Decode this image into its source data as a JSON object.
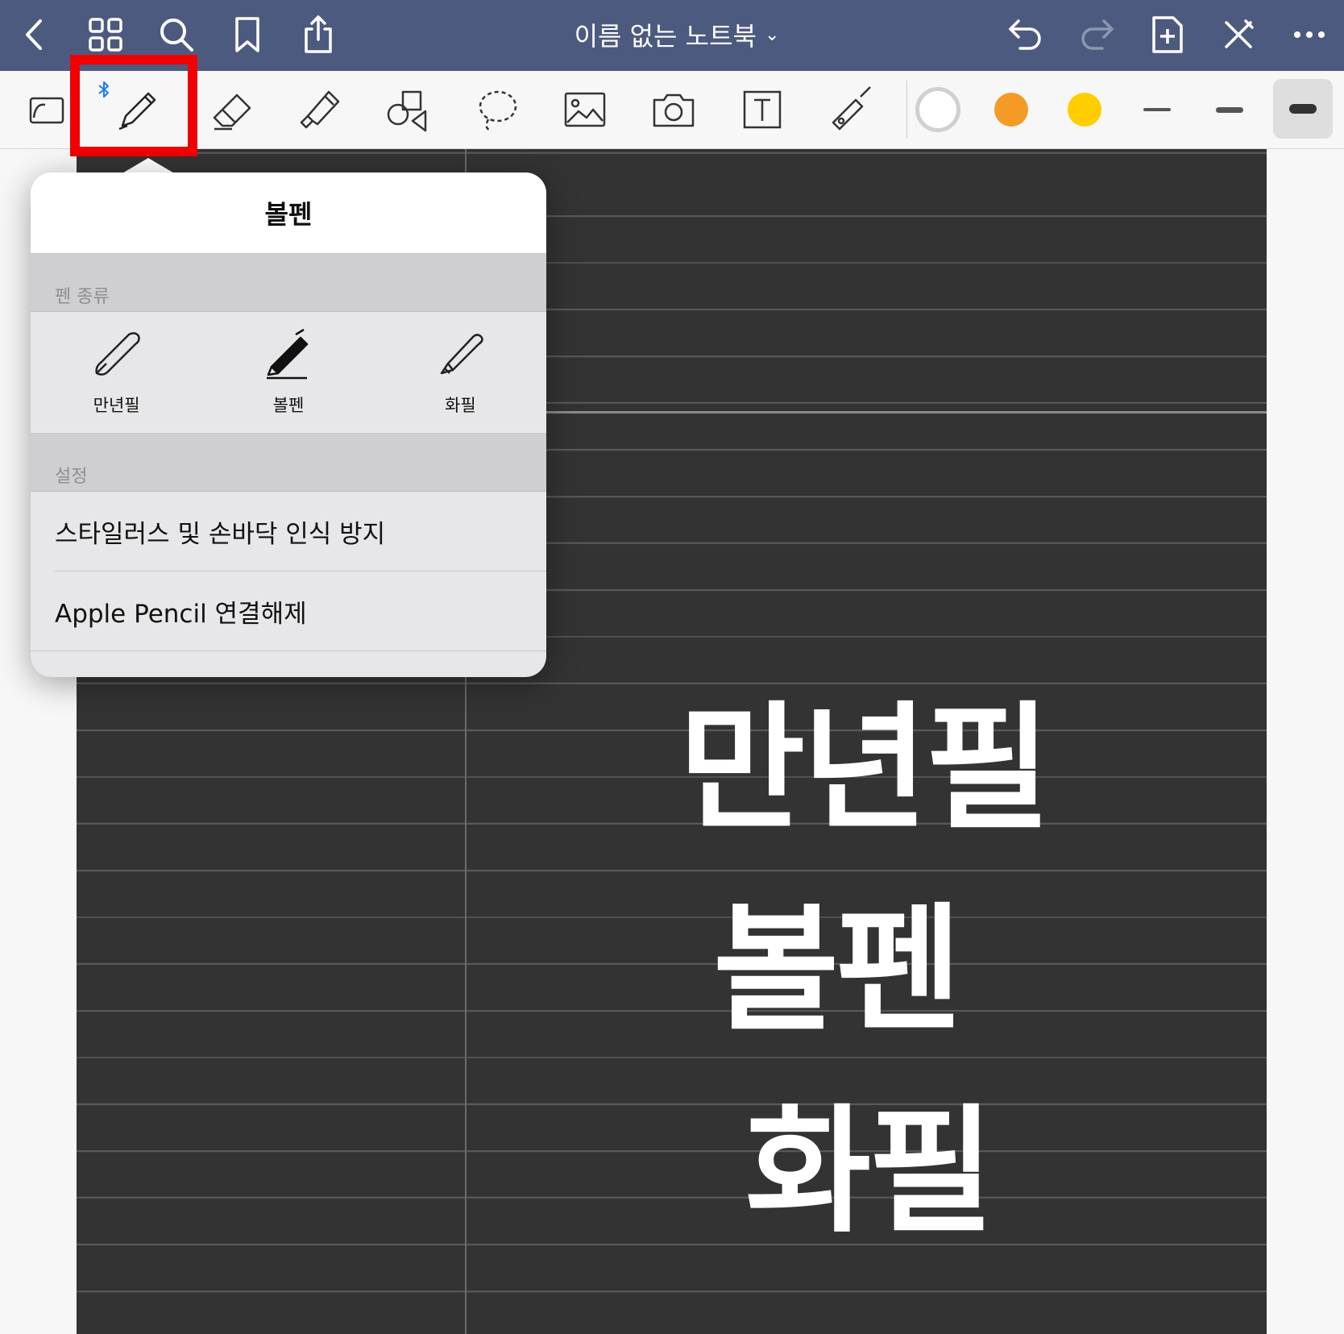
{
  "topbar": {
    "title": "이름 없는 노트북",
    "left_icons": [
      "back-chevron-icon",
      "grid-icon",
      "search-icon",
      "bookmark-icon",
      "share-icon"
    ],
    "right_icons": [
      "undo-icon",
      "redo-icon",
      "add-page-icon",
      "close-tools-icon",
      "more-icon"
    ]
  },
  "toolbar": {
    "tools": [
      "read-mode-icon",
      "pen-icon",
      "eraser-icon",
      "highlighter-icon",
      "shapes-icon",
      "lasso-icon",
      "image-icon",
      "camera-icon",
      "text-icon",
      "laser-pointer-icon"
    ],
    "active_tool": "pen-icon",
    "bluetooth": "connected",
    "colors": [
      "#ffffff",
      "#f49a27",
      "#ffcd00"
    ],
    "widths": [
      "thin",
      "medium",
      "thick"
    ],
    "selected_width": "thick"
  },
  "popover": {
    "title": "볼펜",
    "pen_type_label": "펜 종류",
    "pen_types": [
      {
        "label": "만년필",
        "icon": "fountain-pen-icon"
      },
      {
        "label": "볼펜",
        "icon": "ballpoint-pen-icon"
      },
      {
        "label": "화필",
        "icon": "brush-pen-icon"
      }
    ],
    "settings_label": "설정",
    "settings": [
      {
        "label": "스타일러스 및 손바닥 인식 방지"
      },
      {
        "label": "Apple Pencil 연결해제"
      }
    ]
  },
  "note": {
    "handwriting": [
      "만년필",
      "볼펜",
      "화필"
    ]
  }
}
